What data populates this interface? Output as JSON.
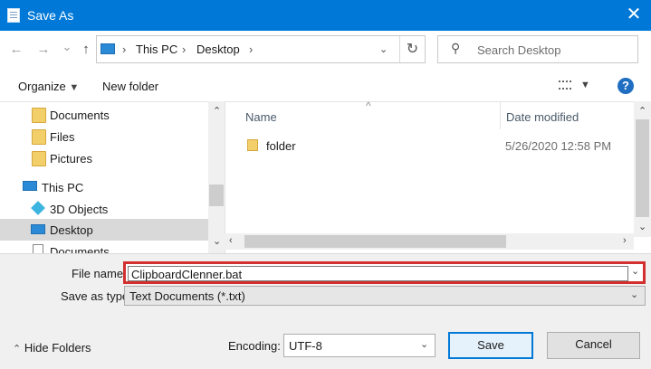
{
  "window": {
    "title": "Save As",
    "close_glyph": "✕"
  },
  "nav": {
    "back_glyph": "←",
    "forward_glyph": "→",
    "recent_glyph": "⌄",
    "up_glyph": "↑",
    "breadcrumb": [
      "This PC",
      "Desktop"
    ],
    "sep_glyph": "›",
    "refresh_glyph": "↻",
    "search_placeholder": "Search Desktop"
  },
  "toolbar": {
    "organize": "Organize",
    "new_folder": "New folder",
    "help": "?"
  },
  "sidebar": {
    "items": [
      {
        "label": "Documents",
        "icon": "folder-icon"
      },
      {
        "label": "Files",
        "icon": "folder-icon"
      },
      {
        "label": "Pictures",
        "icon": "folder-icon"
      },
      {
        "label": "This PC",
        "icon": "computer-icon"
      },
      {
        "label": "3D Objects",
        "icon": "cube-icon"
      },
      {
        "label": "Desktop",
        "icon": "desktop-icon",
        "selected": true
      },
      {
        "label": "Documents",
        "icon": "document-icon"
      }
    ]
  },
  "filelist": {
    "columns": {
      "name": "Name",
      "date": "Date modified"
    },
    "rows": [
      {
        "name": "folder",
        "date": "5/26/2020 12:58 PM"
      }
    ]
  },
  "form": {
    "file_name_label": "File name:",
    "file_name_value": "ClipboardClenner.bat",
    "save_as_type_label": "Save as type:",
    "save_as_type_value": "Text Documents (*.txt)",
    "encoding_label": "Encoding:",
    "encoding_value": "UTF-8"
  },
  "footer": {
    "hide_folders": "Hide Folders",
    "save": "Save",
    "cancel": "Cancel"
  },
  "colors": {
    "titlebar": "#0078d7",
    "highlight": "#d32f2f",
    "accent": "#0078d7"
  }
}
